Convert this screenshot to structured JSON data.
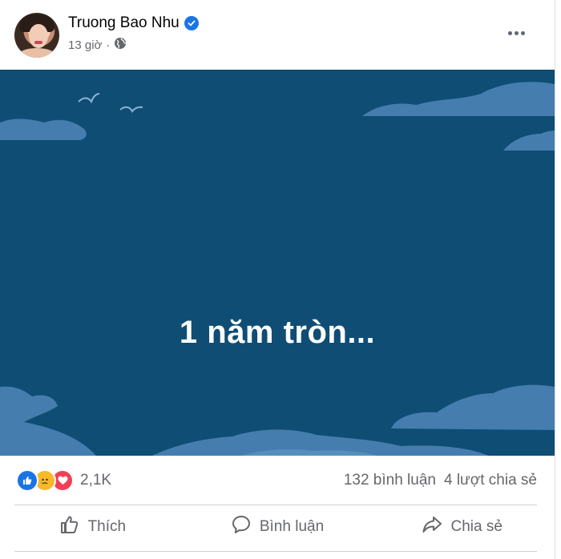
{
  "post": {
    "author_name": "Truong Bao Nhu",
    "verified_icon": "verified-badge-icon",
    "time": "13 giờ",
    "separator": "·",
    "privacy_icon": "globe-icon",
    "more_icon": "more-options-icon",
    "body_text": "1 năm tròn...",
    "background_color": "#0f4d75"
  },
  "stats": {
    "reaction_icons": [
      "like-reaction-icon",
      "sad-reaction-icon",
      "love-reaction-icon"
    ],
    "reaction_count": "2,1K",
    "comments": "132 bình luận",
    "shares": "4 lượt chia sẻ"
  },
  "actions": {
    "like_label": "Thích",
    "comment_label": "Bình luận",
    "share_label": "Chia sẻ"
  },
  "colors": {
    "accent": "#1b74e4",
    "muted_text": "#65676b",
    "like": "#1b74e4",
    "sad": "#f7b928",
    "love": "#f33e58"
  }
}
